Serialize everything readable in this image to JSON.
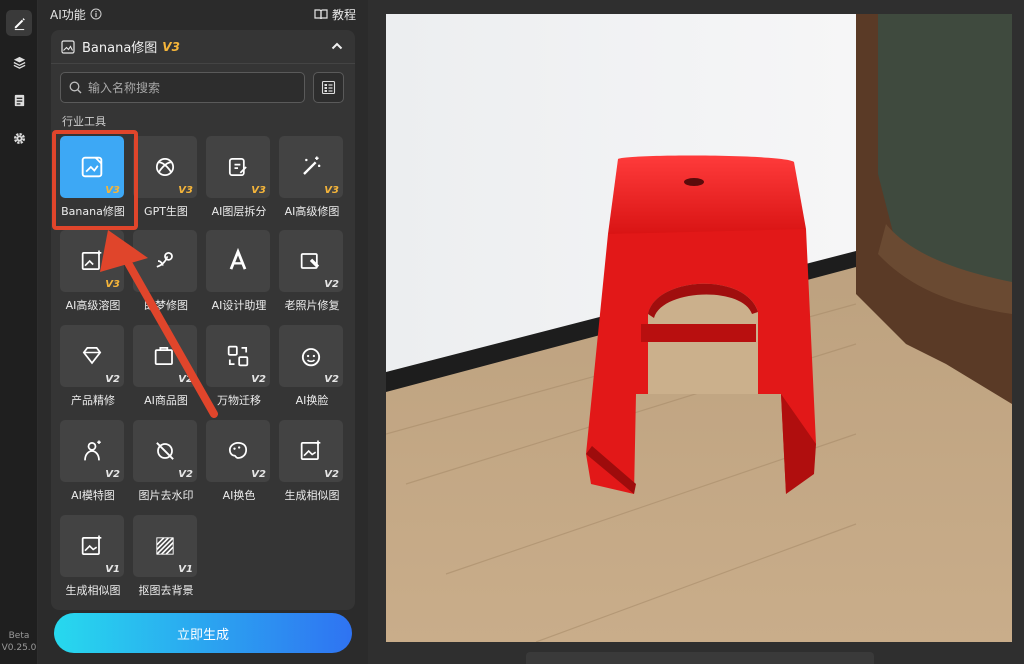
{
  "header": {
    "ai_features": "AI功能",
    "tutorial": "教程"
  },
  "tool_card": {
    "title": "Banana修图",
    "badge": "V3",
    "search_placeholder": "输入名称搜索",
    "section_label": "行业工具"
  },
  "tools": [
    {
      "label": "Banana修图",
      "badge": "V3",
      "icon": "image-edit-icon",
      "selected": true
    },
    {
      "label": "GPT生图",
      "badge": "V3",
      "icon": "gpt-knot-icon"
    },
    {
      "label": "AI图层拆分",
      "badge": "V3",
      "icon": "layer-split-icon"
    },
    {
      "label": "AI高级修图",
      "badge": "V3",
      "icon": "magic-wand-icon"
    },
    {
      "label": "AI高级溶图",
      "badge": "V3",
      "icon": "image-blend-icon"
    },
    {
      "label": "即梦修图",
      "badge": "",
      "icon": "satellite-icon"
    },
    {
      "label": "AI设计助理",
      "badge": "",
      "icon": "design-assistant-icon"
    },
    {
      "label": "老照片修复",
      "badge": "V2",
      "icon": "photo-repair-icon"
    },
    {
      "label": "产品精修",
      "badge": "V2",
      "icon": "diamond-icon"
    },
    {
      "label": "AI商品图",
      "badge": "V2",
      "icon": "product-image-icon"
    },
    {
      "label": "万物迁移",
      "badge": "V2",
      "icon": "transfer-icon"
    },
    {
      "label": "AI换脸",
      "badge": "V2",
      "icon": "face-swap-icon"
    },
    {
      "label": "AI模特图",
      "badge": "V2",
      "icon": "model-icon"
    },
    {
      "label": "图片去水印",
      "badge": "V2",
      "icon": "remove-watermark-icon"
    },
    {
      "label": "AI换色",
      "badge": "V2",
      "icon": "palette-icon"
    },
    {
      "label": "生成相似图",
      "badge": "V2",
      "icon": "similar-image-icon"
    },
    {
      "label": "生成相似图",
      "badge": "V1",
      "icon": "similar-image-icon"
    },
    {
      "label": "抠图去背景",
      "badge": "V1",
      "icon": "remove-background-icon"
    }
  ],
  "generate_button": "立即生成",
  "version": {
    "line1": "Beta",
    "line2": "V0.25.0"
  },
  "colors": {
    "accent": "#3da8f5",
    "badge": "#f5b53a",
    "highlight": "#e0452b"
  }
}
